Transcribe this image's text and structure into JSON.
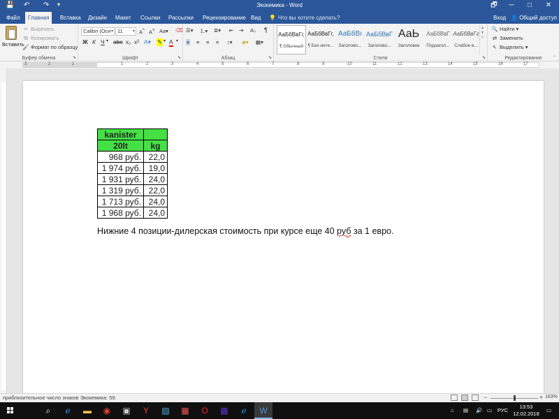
{
  "window": {
    "title": "Экокемика - Word",
    "buttons": {
      "restore": "🗗",
      "minimize": "─",
      "maximize": "□",
      "close": "✕"
    }
  },
  "tabs": [
    "Файл",
    "Главная",
    "Вставка",
    "Дизайн",
    "Макет",
    "Ссылки",
    "Рассылки",
    "Рецензирование",
    "Вид"
  ],
  "active_tab": "Главная",
  "tell_me": "Что вы хотите сделать?",
  "account": {
    "login": "Вход",
    "share": "Общий доступ"
  },
  "clipboard": {
    "paste": "Вставить",
    "cut": "Вырезать",
    "copy": "Копировать",
    "format_painter": "Формат по образцу",
    "label": "Буфер обмена"
  },
  "font": {
    "name": "Calibri (Осн",
    "size": "11",
    "label": "Шрифт",
    "bold": "Ж",
    "italic": "К",
    "underline": "Ч"
  },
  "paragraph": {
    "label": "Абзац"
  },
  "styles": {
    "label": "Стили",
    "items": [
      {
        "sample": "АаБбВвГг,",
        "name": "¶ Обычный"
      },
      {
        "sample": "АаБбВвГг,",
        "name": "¶ Без инте..."
      },
      {
        "sample": "АаБбВı",
        "name": "Заголово..."
      },
      {
        "sample": "АаБбВвГ",
        "name": "Заголово..."
      },
      {
        "sample": "АаЬ",
        "name": "Заголовок"
      },
      {
        "sample": "АаБбВвГ",
        "name": "Подзагол..."
      },
      {
        "sample": "АаБбВвГг",
        "name": "Слабое в..."
      }
    ]
  },
  "editing": {
    "label": "Редактирование",
    "find": "Найти",
    "replace": "Заменить",
    "select": "Выделить"
  },
  "ruler": {
    "marks": [
      "3",
      "2",
      "1",
      "1",
      "2",
      "3",
      "4",
      "5",
      "6",
      "7",
      "8",
      "9",
      "10",
      "11",
      "12",
      "13",
      "14",
      "15",
      "16",
      "17"
    ]
  },
  "document": {
    "table": {
      "header_row1": "kanister",
      "header_row2_col1": "20lt",
      "header_row2_col2": "kg",
      "rows": [
        {
          "price": "968 руб.",
          "kg": "22,0"
        },
        {
          "price": "1 974 руб.",
          "kg": "19,0"
        },
        {
          "price": "1 931 руб.",
          "kg": "24,0"
        },
        {
          "price": "1 319 руб.",
          "kg": "22,0"
        },
        {
          "price": "1 713 руб.",
          "kg": "24,0"
        },
        {
          "price": "1 968 руб.",
          "kg": "24,0"
        }
      ]
    },
    "note_before": "Нижние 4 позиции-дилерская стоимость при курсе еще 40 ",
    "note_squiggle": "руб",
    "note_after": " за 1 евро."
  },
  "status": {
    "word_count": "приблизительное число знаков Экокемика: 59.",
    "zoom": "163%"
  },
  "taskbar": {
    "lang": "РУС",
    "time": "13:53",
    "date": "12.02.2018"
  },
  "colors": {
    "title_bar": "#2b579a",
    "table_header": "#44e044",
    "taskbar": "#101010"
  }
}
